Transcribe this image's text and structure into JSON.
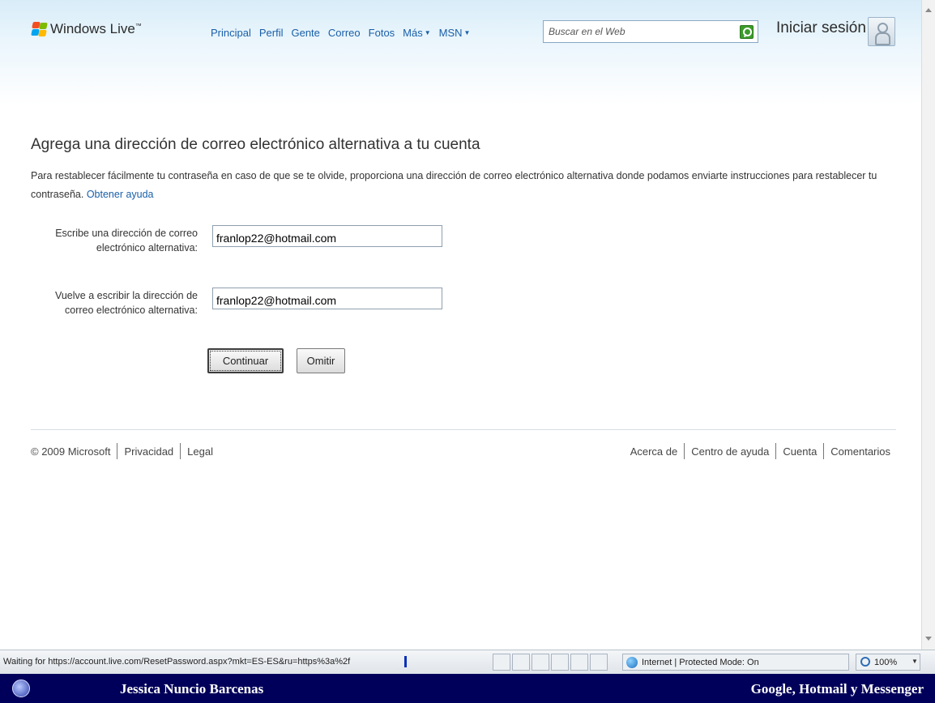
{
  "colors": {
    "link": "#1a5fa8",
    "header_gradient_top": "#d8ecf8",
    "search_button": "#3d9b2c",
    "caption_bar": "#00005a"
  },
  "header": {
    "brand": "Windows Live",
    "brand_tm": "™",
    "nav": [
      {
        "label": "Principal"
      },
      {
        "label": "Perfil"
      },
      {
        "label": "Gente"
      },
      {
        "label": "Correo"
      },
      {
        "label": "Fotos"
      },
      {
        "label": "Más",
        "dropdown": true
      },
      {
        "label": "MSN",
        "dropdown": true
      }
    ],
    "search_placeholder": "Buscar en el Web",
    "search_icon": "search-icon",
    "signin_label": "Iniciar sesión",
    "signin_icon": "user-icon"
  },
  "main": {
    "title": "Agrega una dirección de correo electrónico alternativa a tu cuenta",
    "description": "Para restablecer fácilmente tu contraseña en caso de que se te olvide, proporciona una dirección de correo electrónico alternativa donde podamos enviarte instrucciones para restablecer tu contraseña.",
    "help_link": "Obtener ayuda",
    "field1": {
      "label_line1": "Escribe una dirección de correo",
      "label_line2": "electrónico alternativa:",
      "value": "franlop22@hotmail.com"
    },
    "field2": {
      "label_line1": "Vuelve a escribir la dirección de",
      "label_line2": "correo electrónico alternativa:",
      "value": "franlop22@hotmail.com"
    },
    "continue_label": "Continuar",
    "skip_label": "Omitir"
  },
  "footer": {
    "copyright": "© 2009 Microsoft",
    "left_links": [
      "Privacidad",
      "Legal"
    ],
    "right_links": [
      "Acerca de",
      "Centro de ayuda",
      "Cuenta",
      "Comentarios"
    ]
  },
  "statusbar": {
    "status_text": "Waiting for https://account.live.com/ResetPassword.aspx?mkt=ES-ES&ru=https%3a%2f",
    "zone": "Internet | Protected Mode: On",
    "zoom": "100%"
  },
  "caption": {
    "left": "Jessica Nuncio Barcenas",
    "right": "Google, Hotmail y Messenger"
  }
}
